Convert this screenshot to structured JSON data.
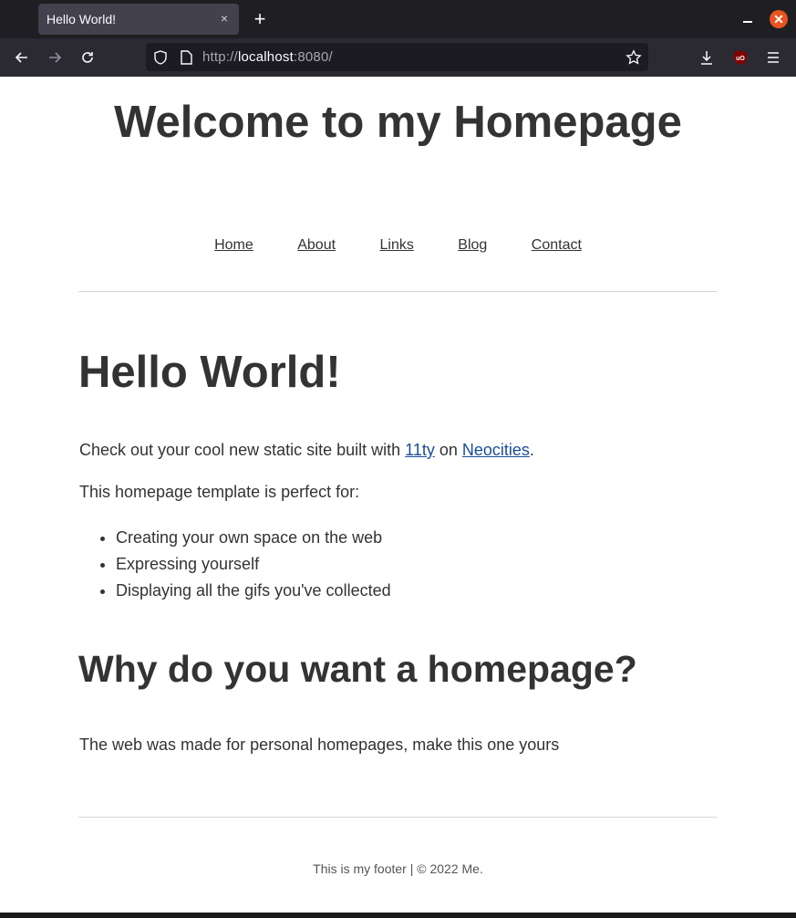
{
  "browser": {
    "tab_title": "Hello World!",
    "tab_close": "×",
    "new_tab": "+",
    "window_close": "✕",
    "url_prefix": "http://",
    "url_host": "localhost",
    "url_suffix": ":8080/",
    "ublock_badge": "uO"
  },
  "site": {
    "title": "Welcome to my Homepage",
    "nav": [
      "Home",
      "About",
      "Links",
      "Blog",
      "Contact"
    ]
  },
  "main": {
    "heading": "Hello World!",
    "intro_before": "Check out your cool new static site built with ",
    "link_11ty": "11ty",
    "intro_middle": " on ",
    "link_neocities": "Neocities",
    "intro_after": ".",
    "template_line": "This homepage template is perfect for:",
    "list": [
      "Creating your own space on the web",
      "Expressing yourself",
      "Displaying all the gifs you've collected"
    ],
    "heading2": "Why do you want a homepage?",
    "reason": "The web was made for personal homepages, make this one yours"
  },
  "footer": {
    "text": "This is my footer | © 2022 Me."
  },
  "colors": {
    "text": "#333333",
    "link": "#1a4d99",
    "chrome_dark": "#1f1e22",
    "chrome_toolbar": "#2b2a33",
    "close_button": "#e95420"
  }
}
